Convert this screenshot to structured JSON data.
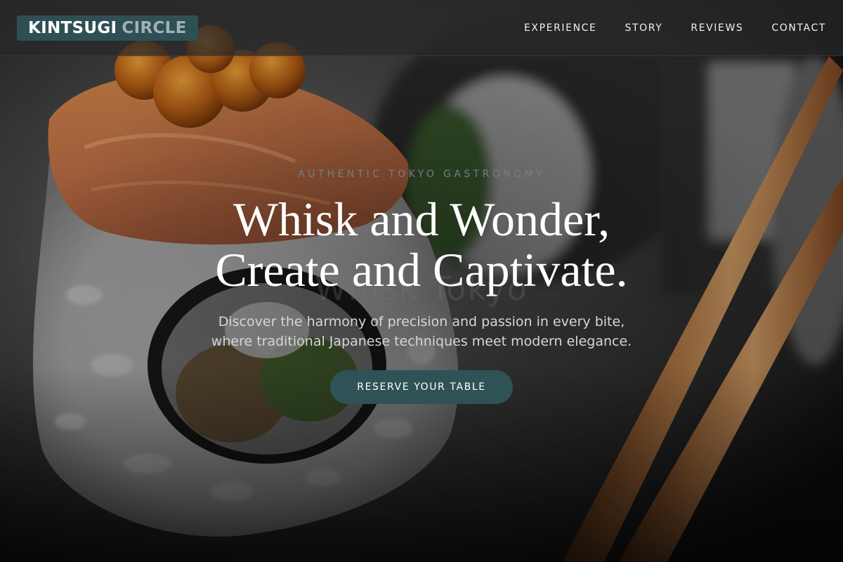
{
  "brand": {
    "name_part_1": "KINTSUGI",
    "name_part_2": "CIRCLE"
  },
  "nav": {
    "items": [
      {
        "label": "EXPERIENCE"
      },
      {
        "label": "STORY"
      },
      {
        "label": "REVIEWS"
      },
      {
        "label": "CONTACT"
      }
    ]
  },
  "hero": {
    "eyebrow": "AUTHENTIC TOKYO GASTRONOMY",
    "ghost_text": "Whisk Tokyo",
    "headline_line_1": "Whisk and Wonder,",
    "headline_line_2": "Create and Captivate.",
    "subtext_line_1": "Discover the harmony of precision and passion in every bite,",
    "subtext_line_2": "where traditional Japanese techniques meet modern elegance.",
    "cta_label": "RESERVE YOUR TABLE"
  },
  "colors": {
    "accent": "#2f5257",
    "logo_bg": "#2f4f55",
    "logo_secondary": "#9fb2b5",
    "eyebrow": "#6f8085",
    "header_bg": "#282828"
  }
}
